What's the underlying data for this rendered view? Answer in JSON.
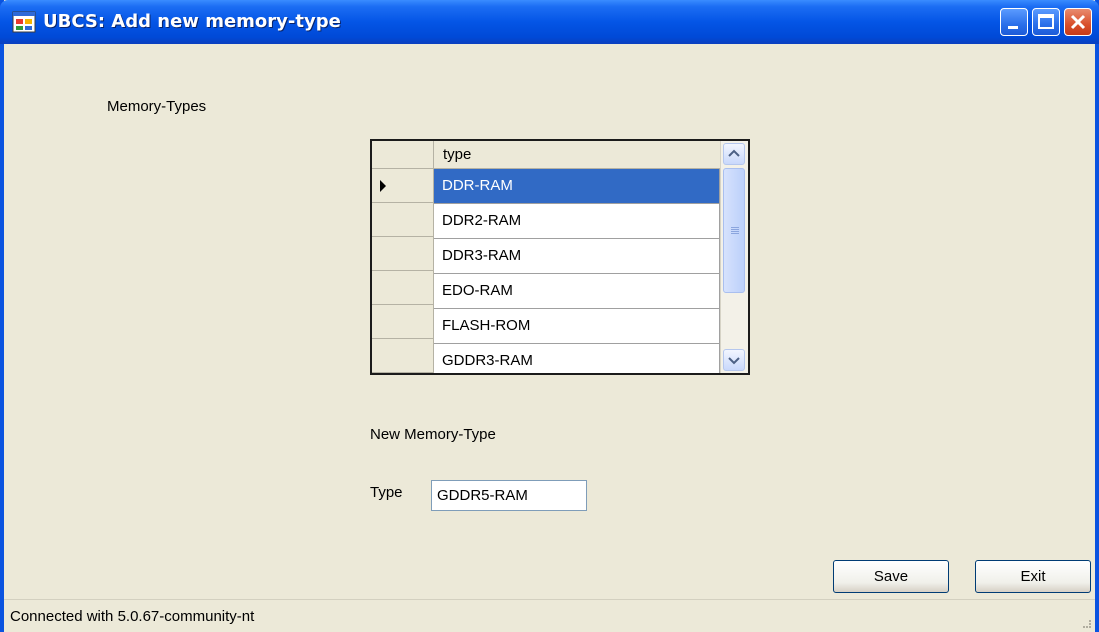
{
  "window": {
    "title": "UBCS: Add new memory-type",
    "controls": [
      "minimize",
      "maximize",
      "close"
    ]
  },
  "memory_types_label": "Memory-Types",
  "grid": {
    "column_header": "type",
    "rows": [
      "DDR-RAM",
      "DDR2-RAM",
      "DDR3-RAM",
      "EDO-RAM",
      "FLASH-ROM",
      "GDDR3-RAM"
    ],
    "selected_index": 0
  },
  "new_type_section": {
    "heading": "New Memory-Type",
    "type_label": "Type",
    "type_value": "GDDR5-RAM"
  },
  "buttons": {
    "save": "Save",
    "exit": "Exit"
  },
  "status": {
    "text": "Connected with 5.0.67-community-nt"
  },
  "colors": {
    "title_bar": "#0455E6",
    "selection": "#316AC5",
    "window_bg": "#ECE9D8"
  }
}
